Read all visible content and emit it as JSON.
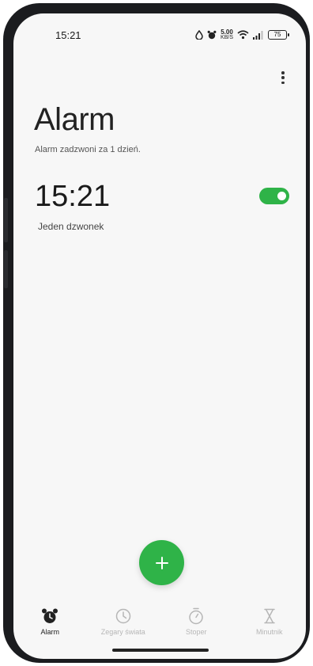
{
  "status_bar": {
    "time": "15:21",
    "speed_value": "5.00",
    "speed_unit": "KB/S",
    "battery": "75",
    "icons": [
      "alarm-drop-icon",
      "alarm-clock-icon",
      "wifi-icon",
      "signal-icon",
      "battery-icon"
    ]
  },
  "header": {
    "title": "Alarm",
    "subtitle": "Alarm zadzwoni za  1 dzień."
  },
  "alarms": [
    {
      "time": "15:21",
      "label": "Jeden dzwonek",
      "enabled": true
    }
  ],
  "nav": {
    "items": [
      {
        "label": "Alarm",
        "icon": "alarm-clock-icon",
        "active": true
      },
      {
        "label": "Zegary świata",
        "icon": "world-clock-icon",
        "active": false
      },
      {
        "label": "Stoper",
        "icon": "stopwatch-icon",
        "active": false
      },
      {
        "label": "Minutnik",
        "icon": "hourglass-icon",
        "active": false
      }
    ]
  },
  "colors": {
    "accent": "#2fb348",
    "background": "#f7f7f7",
    "text": "#222222",
    "inactive": "#b6b6b6"
  }
}
